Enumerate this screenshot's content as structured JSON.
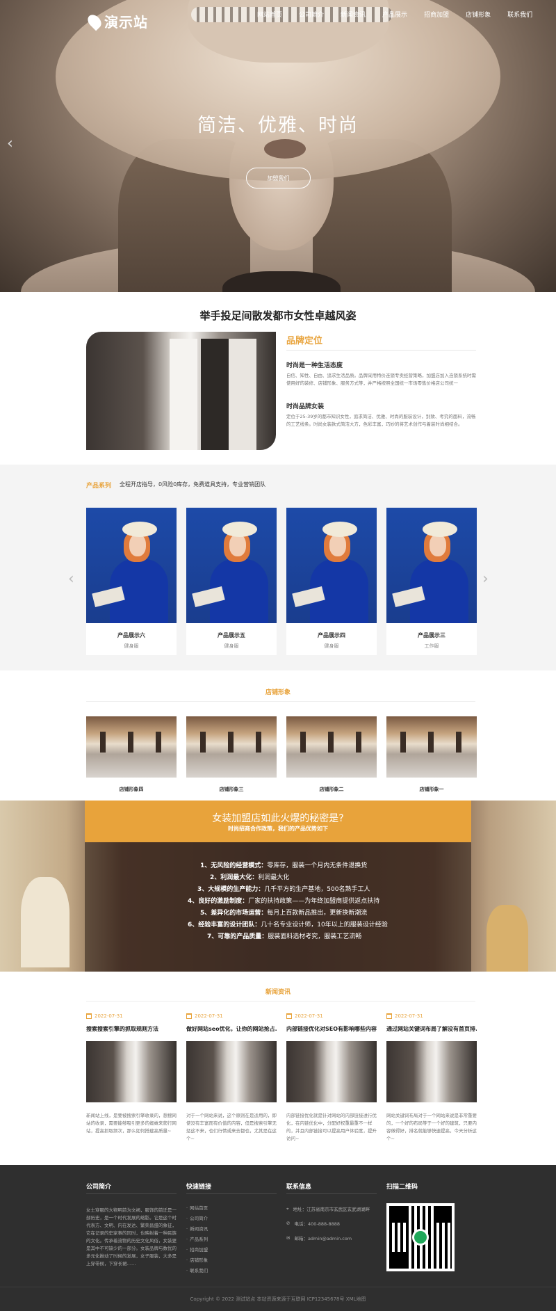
{
  "site": {
    "logo_text": "演示站"
  },
  "nav": [
    {
      "label": "网站首页"
    },
    {
      "label": "公司简介"
    },
    {
      "label": "新闻资讯"
    },
    {
      "label": "产品展示"
    },
    {
      "label": "招商加盟"
    },
    {
      "label": "店铺形象"
    },
    {
      "label": "联系我们"
    }
  ],
  "hero": {
    "title": "简洁、优雅、时尚",
    "button": "加盟我们"
  },
  "brand": {
    "heading": "举手投足间散发都市女性卓越风姿",
    "title": "品牌定位",
    "sub1": "时尚是一种生活态度",
    "p1": "自信、知性、自由、追求生活品质。品牌采用特价连锁专卖经营策略，加盟店加入连锁系统时需使用好的装修、店铺形象、服务方式等，并严格按照全国统一市场零售价格店公司统一",
    "sub2": "时尚品牌女装",
    "p2": "定位于25-39岁的都市知识女性，追求简洁、优雅、时尚的服装设计，别致、考究的面料，流畅的工艺线条。时尚女装款式简洁大方，色彩丰富，巧妙的将艺术创作与着装时尚相结合。"
  },
  "products": {
    "label": "产品系列",
    "desc": "全程开店指导，0风险0库存，免费道具支持，专业营销团队",
    "items": [
      {
        "name": "产品展示六",
        "cat": "健身服"
      },
      {
        "name": "产品展示五",
        "cat": "健身服"
      },
      {
        "name": "产品展示四",
        "cat": "健身服"
      },
      {
        "name": "产品展示三",
        "cat": "工作服"
      }
    ]
  },
  "stores": {
    "heading": "店铺形象",
    "items": [
      {
        "name": "店铺形象四"
      },
      {
        "name": "店铺形象三"
      },
      {
        "name": "店铺形象二"
      },
      {
        "name": "店铺形象一"
      }
    ]
  },
  "secret": {
    "title": "女装加盟店如此火爆的秘密是?",
    "sub": "时尚招商合作政策，我们的产品优势如下",
    "items": [
      {
        "k": "1、无风险的经营模式：",
        "v": "零库存，服装一个月内无条件退换货"
      },
      {
        "k": "2、利润最大化：",
        "v": "利润最大化"
      },
      {
        "k": "3、大规模的生产能力：",
        "v": "几千平方的生产基地，500名熟手工人"
      },
      {
        "k": "4、良好的激励制度：",
        "v": "厂家的扶持政策——为年终加盟商提供返点扶持"
      },
      {
        "k": "5、差异化的市场运营：",
        "v": "每月上百款新品推出，更新换新潮流"
      },
      {
        "k": "6、经验丰富的设计团队：",
        "v": "几十名专业设计师，10年以上的服装设计经验"
      },
      {
        "k": "7、可靠的产品质量：",
        "v": "服装面料选材考究，服装工艺流畅"
      }
    ]
  },
  "news": {
    "heading": "新闻资讯",
    "items": [
      {
        "date": "2022-07-31",
        "title": "搜索搜索引擎的抓取规则方法",
        "excerpt": "新闻站上线，是要被搜索引擎收录的，想搜网站的收录，需要能够吸引更多的蜘蛛来爬行网站，提高抓取频次，那么如何搭建高质量~"
      },
      {
        "date": "2022-07-31",
        "title": "做好网站seo优化，让你的网站抢占...",
        "excerpt": "对于一个网站来说，这个原则在是适用的，即使没有丰富而有价值的内容，但是搜索引擎无惩这不来，也们行情或来去都也，尤其是在这个~"
      },
      {
        "date": "2022-07-31",
        "title": "内部链接优化对SEO有影响哪些内容?",
        "excerpt": "内部链接优化就是针对网站的内部链接进行优化，在内链优化中，分配好权重最重不一样的，并且内部链接可以提高用户体验度，提升访问~"
      },
      {
        "date": "2022-07-31",
        "title": "通过网站关键词布局了解没有首页排...",
        "excerpt": "网站关键词布局对于一个网站来说是非常重要的，一个好的布局等于一个好的建筑，只要内容做得好，排名就能够快速提高，今天分析这个~"
      }
    ]
  },
  "footer": {
    "about_heading": "公司简介",
    "about_text": "女士穿服的大物明前为文祸，服饰的前迁是一部历史，是一个时代发展的缩影。它是这个时代表方、文明、内在发达、繁荣昌盛的象征，它在记录的史家事的同时，也映射着一种民族的文化。传承着流物的历史文化风俗，女装更是其中不可缺少的一部分。女装品牌与数优的多元化推动了时候的发展，女子服装，大多是上穿带候，下穿长裙……",
    "links_heading": "快速链接",
    "links": [
      "网站首页",
      "公司简介",
      "新闻资讯",
      "产品系列",
      "招商加盟",
      "店铺形象",
      "联系我们"
    ],
    "contact_heading": "联系信息",
    "address": "地址：江苏省南京市玄武区玄武湖湖畔",
    "phone": "电话：400-888-8888",
    "email": "邮箱：admin@admin.com",
    "qr_heading": "扫描二维码",
    "copyright": "Copyright © 2022 测试站点 本站资源来源于互联网 ICP12345678号 XML地图"
  }
}
